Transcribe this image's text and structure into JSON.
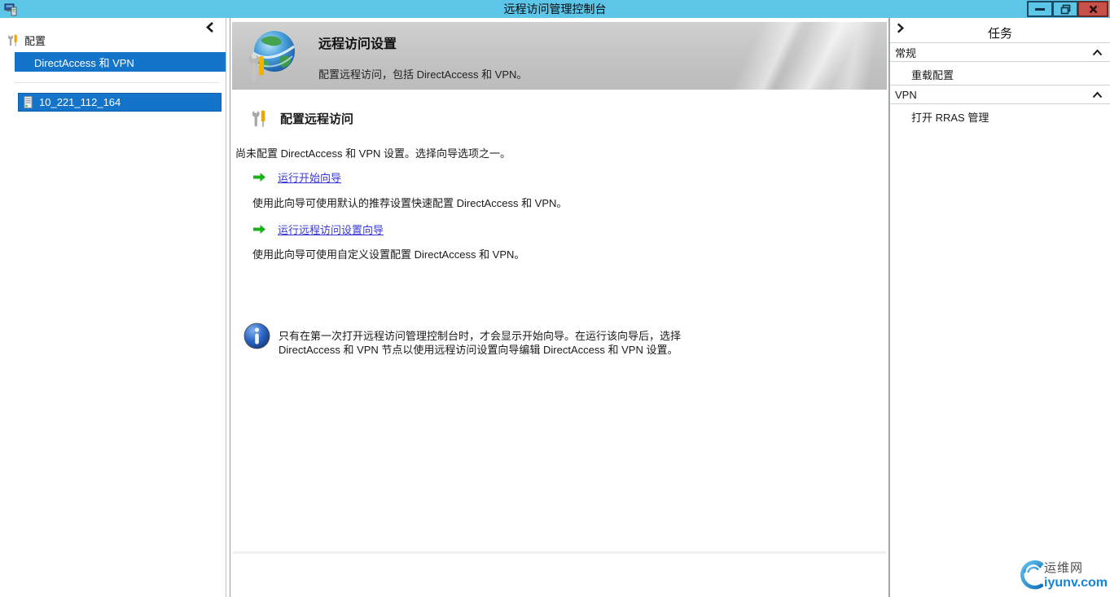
{
  "window": {
    "title": "远程访问管理控制台"
  },
  "sidebar": {
    "root_label": "配置",
    "items": [
      {
        "label": "DirectAccess 和 VPN"
      },
      {
        "label": "10_221_112_164"
      }
    ]
  },
  "main": {
    "banner": {
      "title": "远程访问设置",
      "subtitle": "配置远程访问，包括 DirectAccess 和 VPN。"
    },
    "section_title": "配置远程访问",
    "intro": "尚未配置 DirectAccess 和 VPN 设置。选择向导选项之一。",
    "wizards": [
      {
        "link": "运行开始向导",
        "description": "使用此向导可使用默认的推荐设置快速配置 DirectAccess 和 VPN。"
      },
      {
        "link": "运行远程访问设置向导",
        "description": "使用此向导可使用自定义设置配置 DirectAccess 和 VPN。"
      }
    ],
    "note_line1": "只有在第一次打开远程访问管理控制台时，才会显示开始向导。在运行该向导后，选择",
    "note_line2": "DirectAccess 和 VPN 节点以使用远程访问设置向导编辑 DirectAccess 和 VPN 设置。"
  },
  "tasks": {
    "title": "任务",
    "sections": [
      {
        "header": "常规",
        "items": [
          "重载配置"
        ]
      },
      {
        "header": "VPN",
        "items": [
          "打开 RRAS 管理"
        ]
      }
    ]
  },
  "watermark": {
    "name": "运维网",
    "domain": "iyunv.com"
  },
  "colors": {
    "titlebar": "#5dc6e8",
    "selection_blue": "#1374c9",
    "close_red": "#c75149",
    "link_blue": "#3838d0",
    "arrow_green": "#18b118"
  }
}
